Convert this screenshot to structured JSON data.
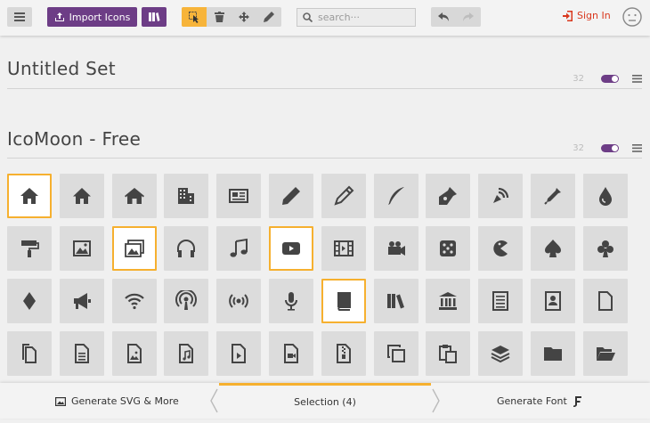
{
  "toolbar": {
    "import_label": "Import Icons",
    "search_placeholder": "search···",
    "signin_label": "Sign In",
    "accent": "#6d3d86",
    "active_tool_color": "#f7b43a",
    "signin_color": "#d9381e"
  },
  "sets": [
    {
      "title": "Untitled Set",
      "count": "32"
    },
    {
      "title": "IcoMoon - Free",
      "count": "32"
    }
  ],
  "icons": [
    [
      "home",
      "home2",
      "home3",
      "office",
      "newspaper",
      "pencil",
      "pencil2",
      "quill",
      "pen",
      "blog",
      "eyedropper",
      "droplet"
    ],
    [
      "paint-format",
      "image",
      "images",
      "headphones",
      "music",
      "play",
      "film",
      "video-camera",
      "dice",
      "pacman",
      "spades",
      "clubs"
    ],
    [
      "diamonds",
      "bullhorn",
      "connection",
      "podcast",
      "feed",
      "mic",
      "book",
      "books",
      "library",
      "file-text",
      "profile",
      "file-empty"
    ],
    [
      "files-empty",
      "file-text2",
      "file-picture",
      "file-music",
      "file-play",
      "file-video",
      "file-zip",
      "copy",
      "paste",
      "stack",
      "folder",
      "folder-open"
    ]
  ],
  "selected_icons": [
    "home",
    "images",
    "play",
    "book"
  ],
  "bottom": {
    "generate_svg_label": "Generate SVG & More",
    "selection_label": "Selection (4)",
    "generate_font_label": "Generate Font",
    "highlight": "#f6b02f"
  }
}
